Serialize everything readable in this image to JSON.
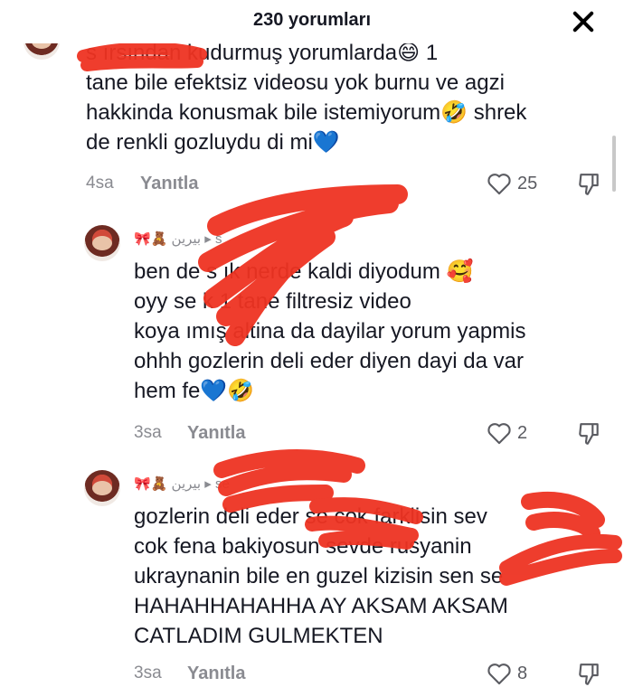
{
  "header": {
    "title": "230 yorumları"
  },
  "comments": [
    {
      "text": "s          ırsından kudurmuş yorumlarda😄 1\ntane bile efektsiz videosu yok burnu ve agzi\nhakkinda konusmak bile istemiyorum🤣 shrek\nde renkli gozluydu di mi💙",
      "time": "4sa",
      "reply": "Yanıtla",
      "likes": "25"
    },
    {
      "user": "🎀🧸 بيرين ▸ s",
      "text": "ben de s      ık nerde kaldi diyodum 🥰\noyy se      k 1 tane filtresiz video\nkoya  ımış altina da dayilar yorum yapmis\nohhh gozlerin deli eder diyen dayi da var\nhem fe💙🤣",
      "time": "3sa",
      "reply": "Yanıtla",
      "likes": "2"
    },
    {
      "user": "🎀🧸 بيرين ▸ se",
      "text": "gozlerin deli eder se       cok farklisin sev\ncok fena bakiyosun sevde rusyanin\nukraynanin bile en guzel kizisin sen se\nHAHAHHAHAHHA AY AKSAM AKSAM\nCATLADIM GULMEKTEN",
      "time": "3sa",
      "reply": "Yanıtla",
      "likes": "8"
    }
  ],
  "colors": {
    "scribble": "#ee3322",
    "muted": "#8a8b91"
  },
  "icons": [
    "close-icon",
    "heart-outline-icon",
    "thumbs-down-icon"
  ]
}
